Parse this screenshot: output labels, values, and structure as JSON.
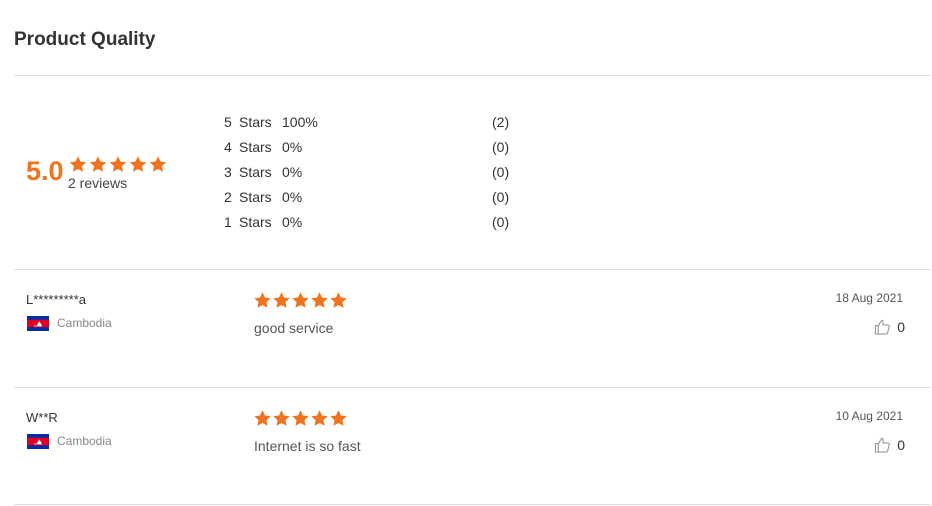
{
  "section_title": "Product Quality",
  "summary": {
    "score": "5.0",
    "rating_stars": 5,
    "review_count": "2 reviews",
    "star_color": "#f0731f"
  },
  "distribution": [
    {
      "stars": "5",
      "label": "Stars",
      "percent": "100%",
      "count": "(2)"
    },
    {
      "stars": "4",
      "label": "Stars",
      "percent": "0%",
      "count": "(0)"
    },
    {
      "stars": "3",
      "label": "Stars",
      "percent": "0%",
      "count": "(0)"
    },
    {
      "stars": "2",
      "label": "Stars",
      "percent": "0%",
      "count": "(0)"
    },
    {
      "stars": "1",
      "label": "Stars",
      "percent": "0%",
      "count": "(0)"
    }
  ],
  "reviews": [
    {
      "name": "L*********a",
      "country": "Cambodia",
      "flag_icon": "cambodia-flag-icon",
      "rating": 5,
      "text": "good service",
      "date": "18 Aug 2021",
      "likes": "0",
      "like_icon": "thumbs-up-icon"
    },
    {
      "name": "W**R",
      "country": "Cambodia",
      "flag_icon": "cambodia-flag-icon",
      "rating": 5,
      "text": "Internet is so fast",
      "date": "10 Aug 2021",
      "likes": "0",
      "like_icon": "thumbs-up-icon"
    }
  ]
}
